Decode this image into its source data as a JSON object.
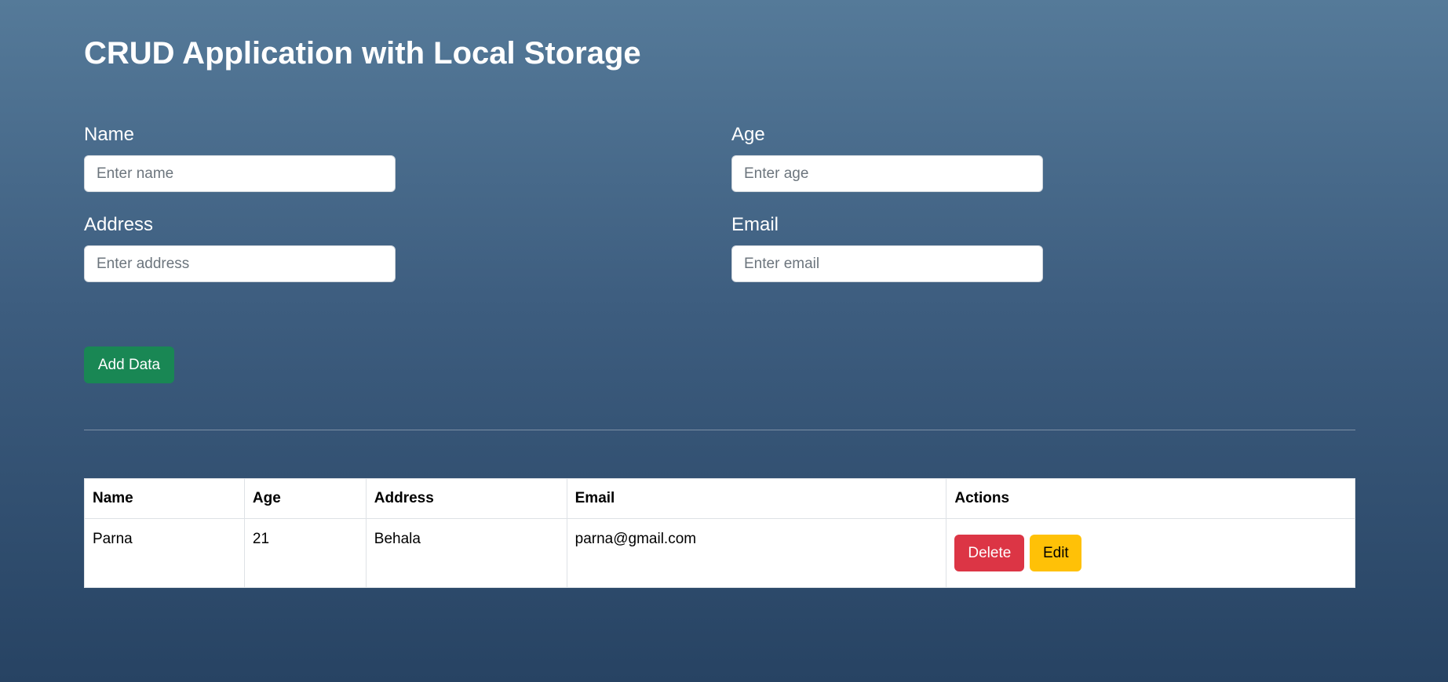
{
  "page": {
    "title": "CRUD Application with Local Storage"
  },
  "form": {
    "name": {
      "label": "Name",
      "placeholder": "Enter name",
      "value": ""
    },
    "age": {
      "label": "Age",
      "placeholder": "Enter age",
      "value": ""
    },
    "address": {
      "label": "Address",
      "placeholder": "Enter address",
      "value": ""
    },
    "email": {
      "label": "Email",
      "placeholder": "Enter email",
      "value": ""
    },
    "add_button_label": "Add Data"
  },
  "table": {
    "headers": [
      "Name",
      "Age",
      "Address",
      "Email",
      "Actions"
    ],
    "rows": [
      {
        "name": "Parna",
        "age": "21",
        "address": "Behala",
        "email": "parna@gmail.com",
        "delete_label": "Delete",
        "edit_label": "Edit"
      }
    ]
  },
  "colors": {
    "background_top": "#557a99",
    "background_bottom": "#274363",
    "add_button": "#198754",
    "delete_button": "#dc3545",
    "edit_button": "#ffc107"
  }
}
